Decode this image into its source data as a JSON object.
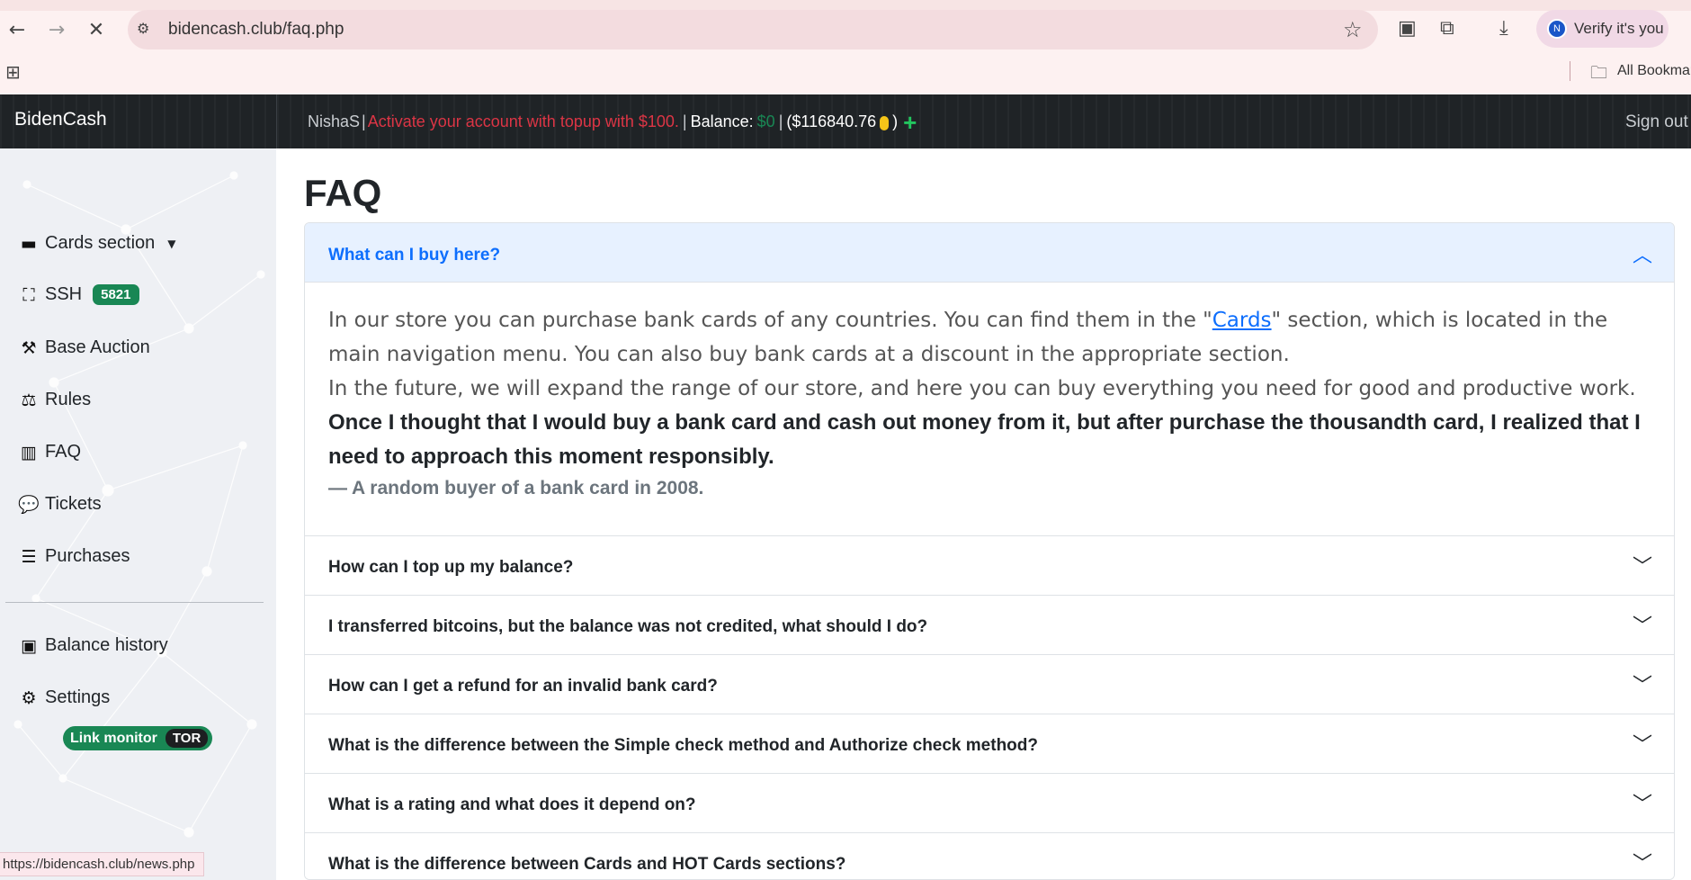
{
  "browser": {
    "url": "bidencash.club/faq.php",
    "verify_label": "Verify it's you",
    "avatar_letter": "N",
    "bookmarks_label": "All Bookmar"
  },
  "navbar": {
    "brand": "BidenCash",
    "username": "NishaS",
    "separator": "|",
    "activate_msg": "Activate your account with topup with $100.",
    "balance_label": "Balance:",
    "balance_value": "$0",
    "usd_open": "($116840.76",
    "usd_close": ")",
    "sign_out": "Sign out"
  },
  "sidebar": {
    "items": [
      {
        "label": "Cards section",
        "icon": "credit-card-icon"
      },
      {
        "label": "SSH",
        "icon": "network-icon",
        "badge": "5821"
      },
      {
        "label": "Base Auction",
        "icon": "gavel-icon"
      },
      {
        "label": "Rules",
        "icon": "rules-icon"
      },
      {
        "label": "FAQ",
        "icon": "map-icon"
      },
      {
        "label": "Tickets",
        "icon": "comments-icon"
      },
      {
        "label": "Purchases",
        "icon": "list-icon"
      },
      {
        "label": "Balance history",
        "icon": "money-bill-icon"
      },
      {
        "label": "Settings",
        "icon": "gear-icon"
      }
    ],
    "link_monitor": "Link monitor",
    "tor_badge": "TOR"
  },
  "status_url": "https://bidencash.club/news.php",
  "main": {
    "title": "FAQ",
    "open_question": "What can I buy here?",
    "answer": {
      "p1_before": "In our store you can purchase bank cards of any countries. You can find them in the \"",
      "p1_link": "Cards",
      "p1_after": "\" section, which is located in the main navigation menu. You can also buy bank cards at a discount in the appropriate section.",
      "p2": "In the future, we will expand the range of our store, and here you can buy everything you need for good and productive work.",
      "quote": "Once I thought that I would buy a bank card and cash out money from it, but after purchase the thousandth card, I realized that I need to approach this moment responsibly.",
      "quote_source": "— A random buyer of a bank card in 2008."
    },
    "questions": [
      "How can I top up my balance?",
      "I transferred bitcoins, but the balance was not credited, what should I do?",
      "How can I get a refund for an invalid bank card?",
      "What is the difference between the Simple check method and Authorize check method?",
      "What is a rating and what does it depend on?",
      "What is the difference between Cards and HOT Cards sections?"
    ]
  }
}
